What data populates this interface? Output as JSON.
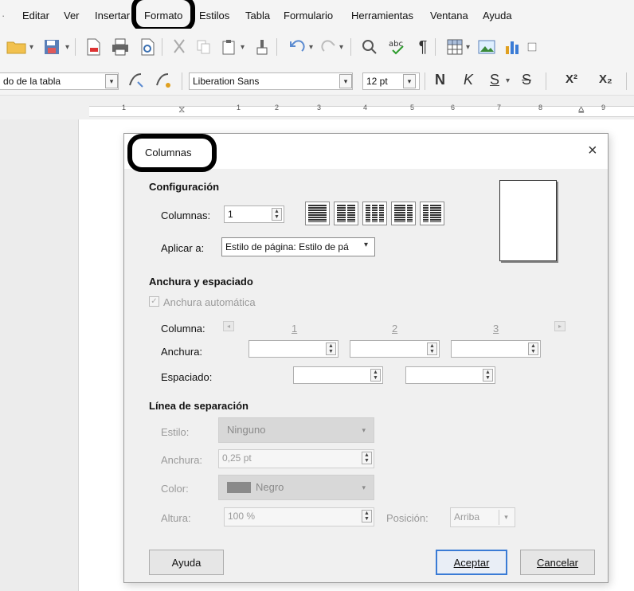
{
  "menubar": {
    "items": [
      "Editar",
      "Ver",
      "Insertar",
      "Formato",
      "Estilos",
      "Tabla",
      "Formulario",
      "Herramientas",
      "Ventana",
      "Ayuda"
    ]
  },
  "toolbar2": {
    "style_name": "do de la tabla",
    "font_name": "Liberation Sans",
    "font_size": "12 pt",
    "bold": "N",
    "italic": "K",
    "underline": "S",
    "strike": "S",
    "superscript": "X²",
    "subscript": "X₂"
  },
  "ruler": {
    "numbers": [
      "1",
      "1",
      "2",
      "3",
      "4",
      "5",
      "6",
      "7",
      "8",
      "9"
    ]
  },
  "dialog": {
    "title": "Columnas",
    "close": "×",
    "config": {
      "heading": "Configuración",
      "columns_label": "Columnas:",
      "columns_value": "1",
      "apply_label": "Aplicar a:",
      "apply_value": "Estilo de página: Estilo de pá"
    },
    "width_spacing": {
      "heading": "Anchura y espaciado",
      "auto_width": "Anchura automática",
      "column_label": "Columna:",
      "col_numbers": [
        "1",
        "2",
        "3"
      ],
      "width_label": "Anchura:",
      "spacing_label": "Espaciado:"
    },
    "separator": {
      "heading": "Línea de separación",
      "style_label": "Estilo:",
      "style_value": "Ninguno",
      "width_label": "Anchura:",
      "width_value": "0,25 pt",
      "color_label": "Color:",
      "color_value": "Negro",
      "height_label": "Altura:",
      "height_value": "100 %",
      "position_label": "Posición:",
      "position_value": "Arriba"
    },
    "buttons": {
      "help": "Ayuda",
      "ok": "Aceptar",
      "cancel": "Cancelar"
    }
  }
}
